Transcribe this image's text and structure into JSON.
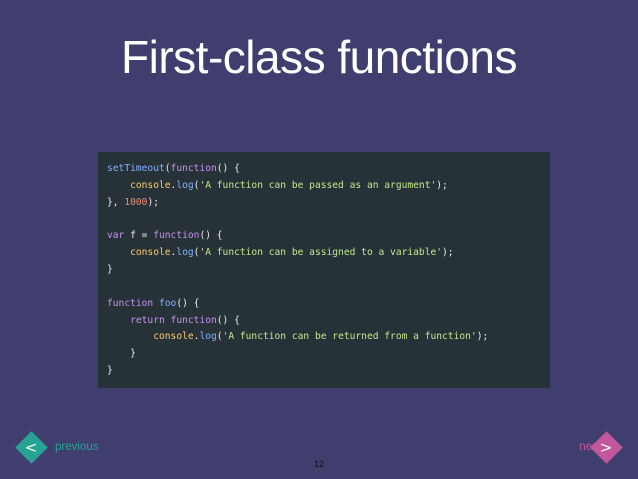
{
  "slide": {
    "title": "First-class functions",
    "page_number": "12"
  },
  "code": {
    "lines": [
      [
        [
          "t-id",
          "setTimeout"
        ],
        [
          "t-paren",
          "("
        ],
        [
          "t-kw",
          "function"
        ],
        [
          "t-paren",
          "() {"
        ]
      ],
      [
        [
          "t-plain",
          "    "
        ],
        [
          "t-fn",
          "console"
        ],
        [
          "t-plain",
          "."
        ],
        [
          "t-id",
          "log"
        ],
        [
          "t-paren",
          "("
        ],
        [
          "t-str",
          "'A function can be passed as an argument'"
        ],
        [
          "t-paren",
          ");"
        ]
      ],
      [
        [
          "t-paren",
          "}, "
        ],
        [
          "t-num",
          "1000"
        ],
        [
          "t-paren",
          ");"
        ]
      ],
      [],
      [
        [
          "t-kw",
          "var"
        ],
        [
          "t-plain",
          " f = "
        ],
        [
          "t-kw",
          "function"
        ],
        [
          "t-paren",
          "() {"
        ]
      ],
      [
        [
          "t-plain",
          "    "
        ],
        [
          "t-fn",
          "console"
        ],
        [
          "t-plain",
          "."
        ],
        [
          "t-id",
          "log"
        ],
        [
          "t-paren",
          "("
        ],
        [
          "t-str",
          "'A function can be assigned to a variable'"
        ],
        [
          "t-paren",
          ");"
        ]
      ],
      [
        [
          "t-paren",
          "}"
        ]
      ],
      [],
      [
        [
          "t-kw",
          "function"
        ],
        [
          "t-plain",
          " "
        ],
        [
          "t-id",
          "foo"
        ],
        [
          "t-paren",
          "() {"
        ]
      ],
      [
        [
          "t-plain",
          "    "
        ],
        [
          "t-kw",
          "return"
        ],
        [
          "t-plain",
          " "
        ],
        [
          "t-kw",
          "function"
        ],
        [
          "t-paren",
          "() {"
        ]
      ],
      [
        [
          "t-plain",
          "        "
        ],
        [
          "t-fn",
          "console"
        ],
        [
          "t-plain",
          "."
        ],
        [
          "t-id",
          "log"
        ],
        [
          "t-paren",
          "("
        ],
        [
          "t-str",
          "'A function can be returned from a function'"
        ],
        [
          "t-paren",
          ");"
        ]
      ],
      [
        [
          "t-plain",
          "    "
        ],
        [
          "t-paren",
          "}"
        ]
      ],
      [
        [
          "t-paren",
          "}"
        ]
      ]
    ]
  },
  "nav": {
    "prev_label": "previous",
    "prev_symbol": "<",
    "next_label": "next",
    "next_symbol": ">"
  },
  "colors": {
    "background": "#3f3e6e",
    "code_background": "#263238",
    "prev_accent": "#27a394",
    "next_accent": "#c2579c"
  }
}
